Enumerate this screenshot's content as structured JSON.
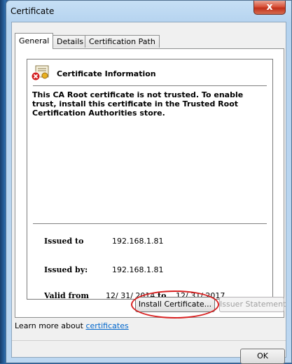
{
  "window": {
    "title": "Certificate",
    "close_label": "x"
  },
  "tabs": [
    {
      "label": "General",
      "active": true
    },
    {
      "label": "Details",
      "active": false
    },
    {
      "label": "Certification Path",
      "active": false
    }
  ],
  "info": {
    "title": "Certificate Information",
    "warning": "This CA Root certificate is not trusted. To enable trust, install this certificate in the Trusted Root Certification Authorities store."
  },
  "fields": {
    "issued_to_label": "Issued to",
    "issued_to_value": "192.168.1.81",
    "issued_by_label": "Issued by:",
    "issued_by_value": "192.168.1.81",
    "valid_from_label": "Valid from",
    "valid_from_value": "12/ 31/ 2014",
    "valid_to_label": "to",
    "valid_to_value": "12/ 31/ 2017"
  },
  "buttons": {
    "install": "Install Certificate...",
    "issuer_statement": "Issuer Statement",
    "ok": "OK"
  },
  "footer": {
    "learn_text": "Learn more about ",
    "learn_link": "certificates"
  },
  "colors": {
    "highlight_ring": "#d82020",
    "link": "#0066cc",
    "close": "#c1301a"
  }
}
